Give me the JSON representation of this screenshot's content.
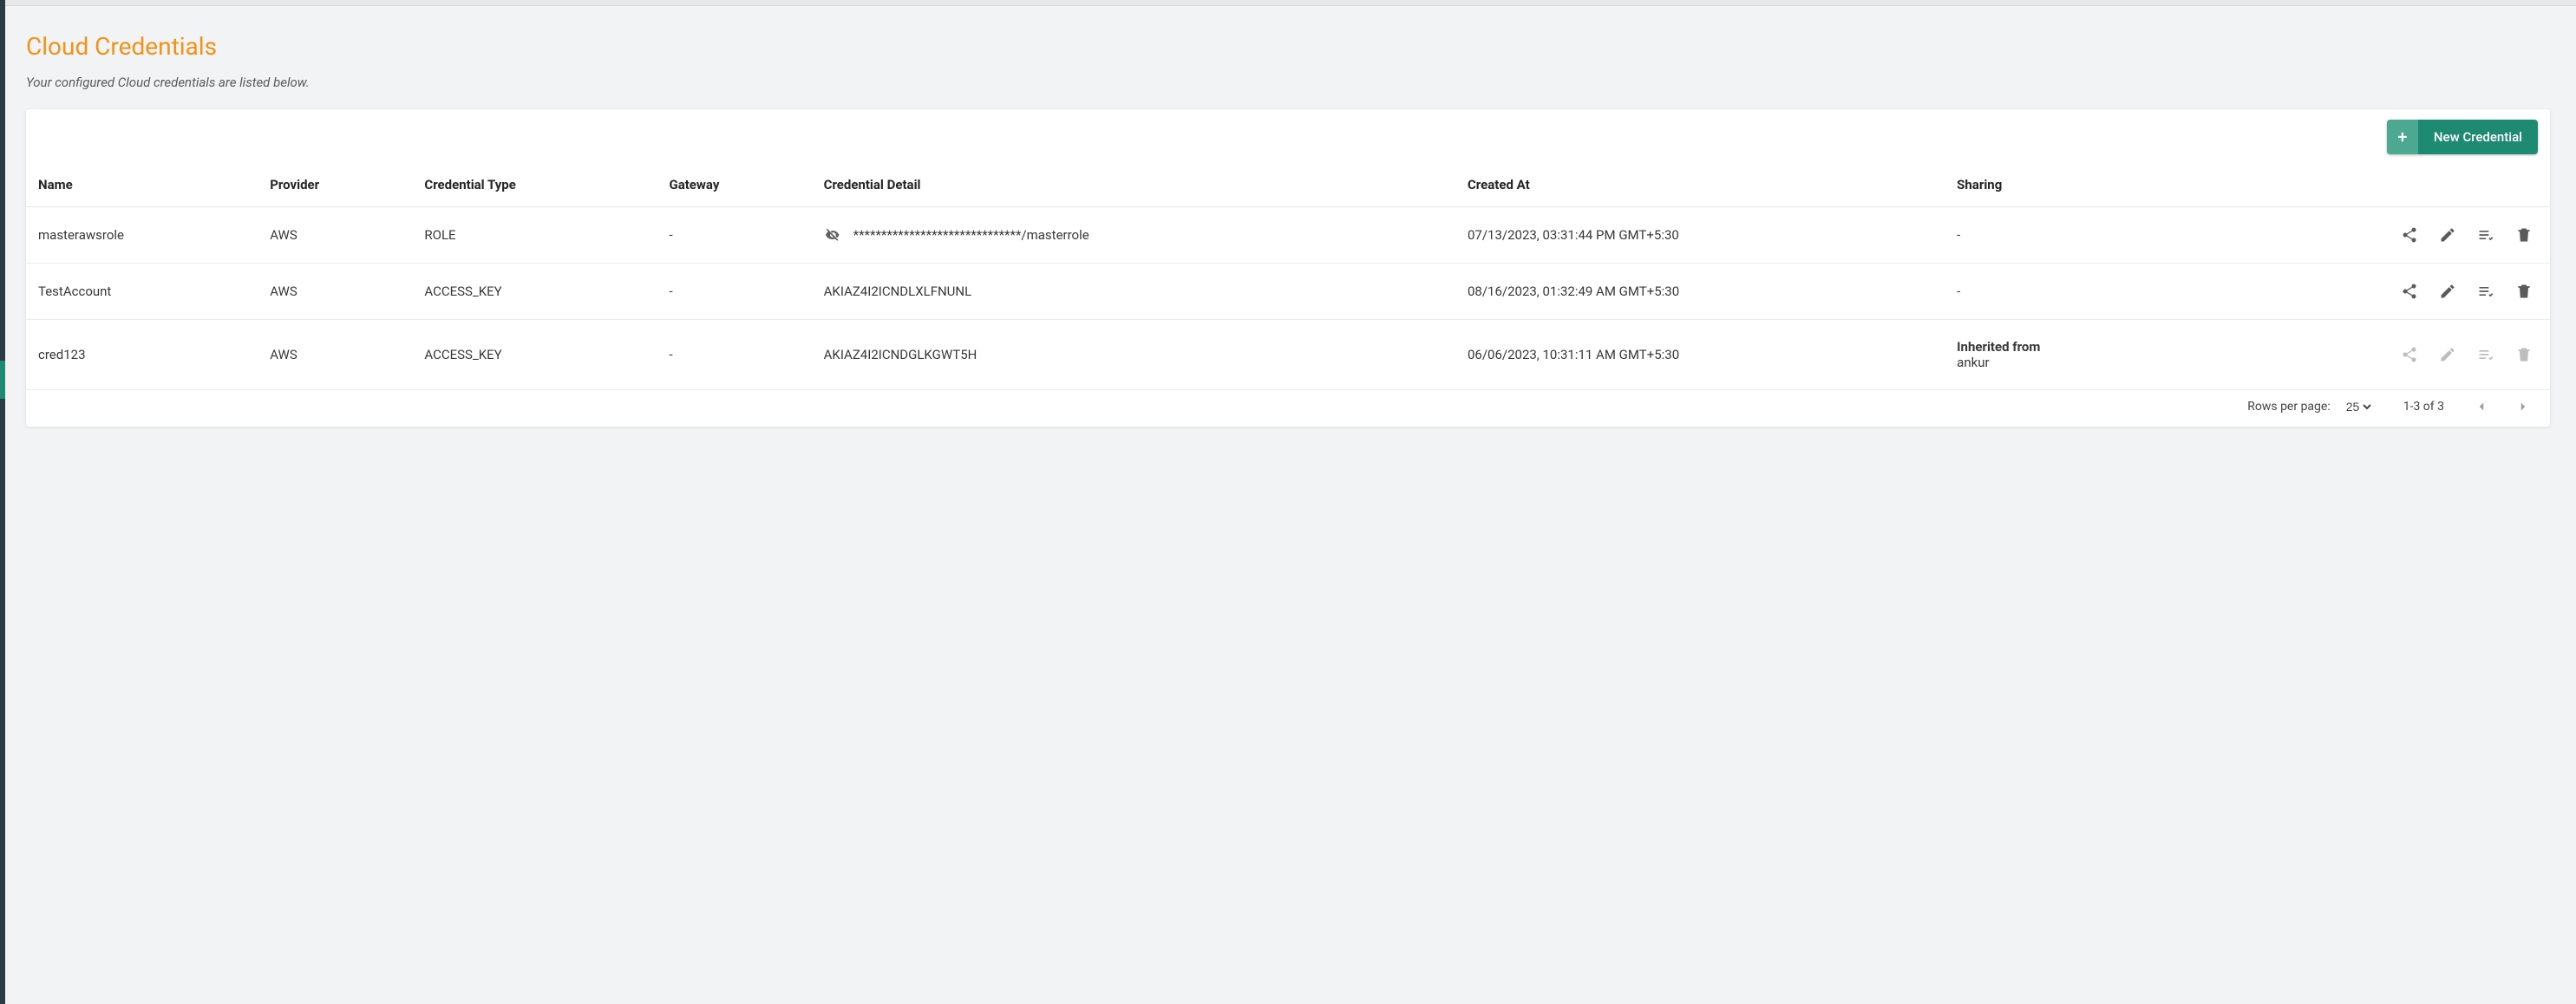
{
  "page": {
    "title": "Cloud Credentials",
    "subtitle": "Your configured Cloud credentials are listed below."
  },
  "actions": {
    "new_label": "New Credential",
    "plus": "+"
  },
  "columns": {
    "name": "Name",
    "provider": "Provider",
    "ctype": "Credential Type",
    "gateway": "Gateway",
    "detail": "Credential Detail",
    "created": "Created At",
    "sharing": "Sharing"
  },
  "rows": [
    {
      "name": "masterawsrole",
      "provider": "AWS",
      "ctype": "ROLE",
      "gateway": "-",
      "detail": "******************************/masterrole",
      "masked": true,
      "created": "07/13/2023, 03:31:44 PM GMT+5:30",
      "sharing_primary": "-",
      "sharing_secondary": "",
      "actions_enabled": true
    },
    {
      "name": "TestAccount",
      "provider": "AWS",
      "ctype": "ACCESS_KEY",
      "gateway": "-",
      "detail": "AKIAZ4I2ICNDLXLFNUNL",
      "masked": false,
      "created": "08/16/2023, 01:32:49 AM GMT+5:30",
      "sharing_primary": "-",
      "sharing_secondary": "",
      "actions_enabled": true
    },
    {
      "name": "cred123",
      "provider": "AWS",
      "ctype": "ACCESS_KEY",
      "gateway": "-",
      "detail": "AKIAZ4I2ICNDGLKGWT5H",
      "masked": false,
      "created": "06/06/2023, 10:31:11 AM GMT+5:30",
      "sharing_primary": "Inherited from",
      "sharing_secondary": "ankur",
      "actions_enabled": false
    }
  ],
  "pager": {
    "rpp_label": "Rows per page:",
    "rpp_value": "25",
    "range": "1-3 of 3"
  }
}
